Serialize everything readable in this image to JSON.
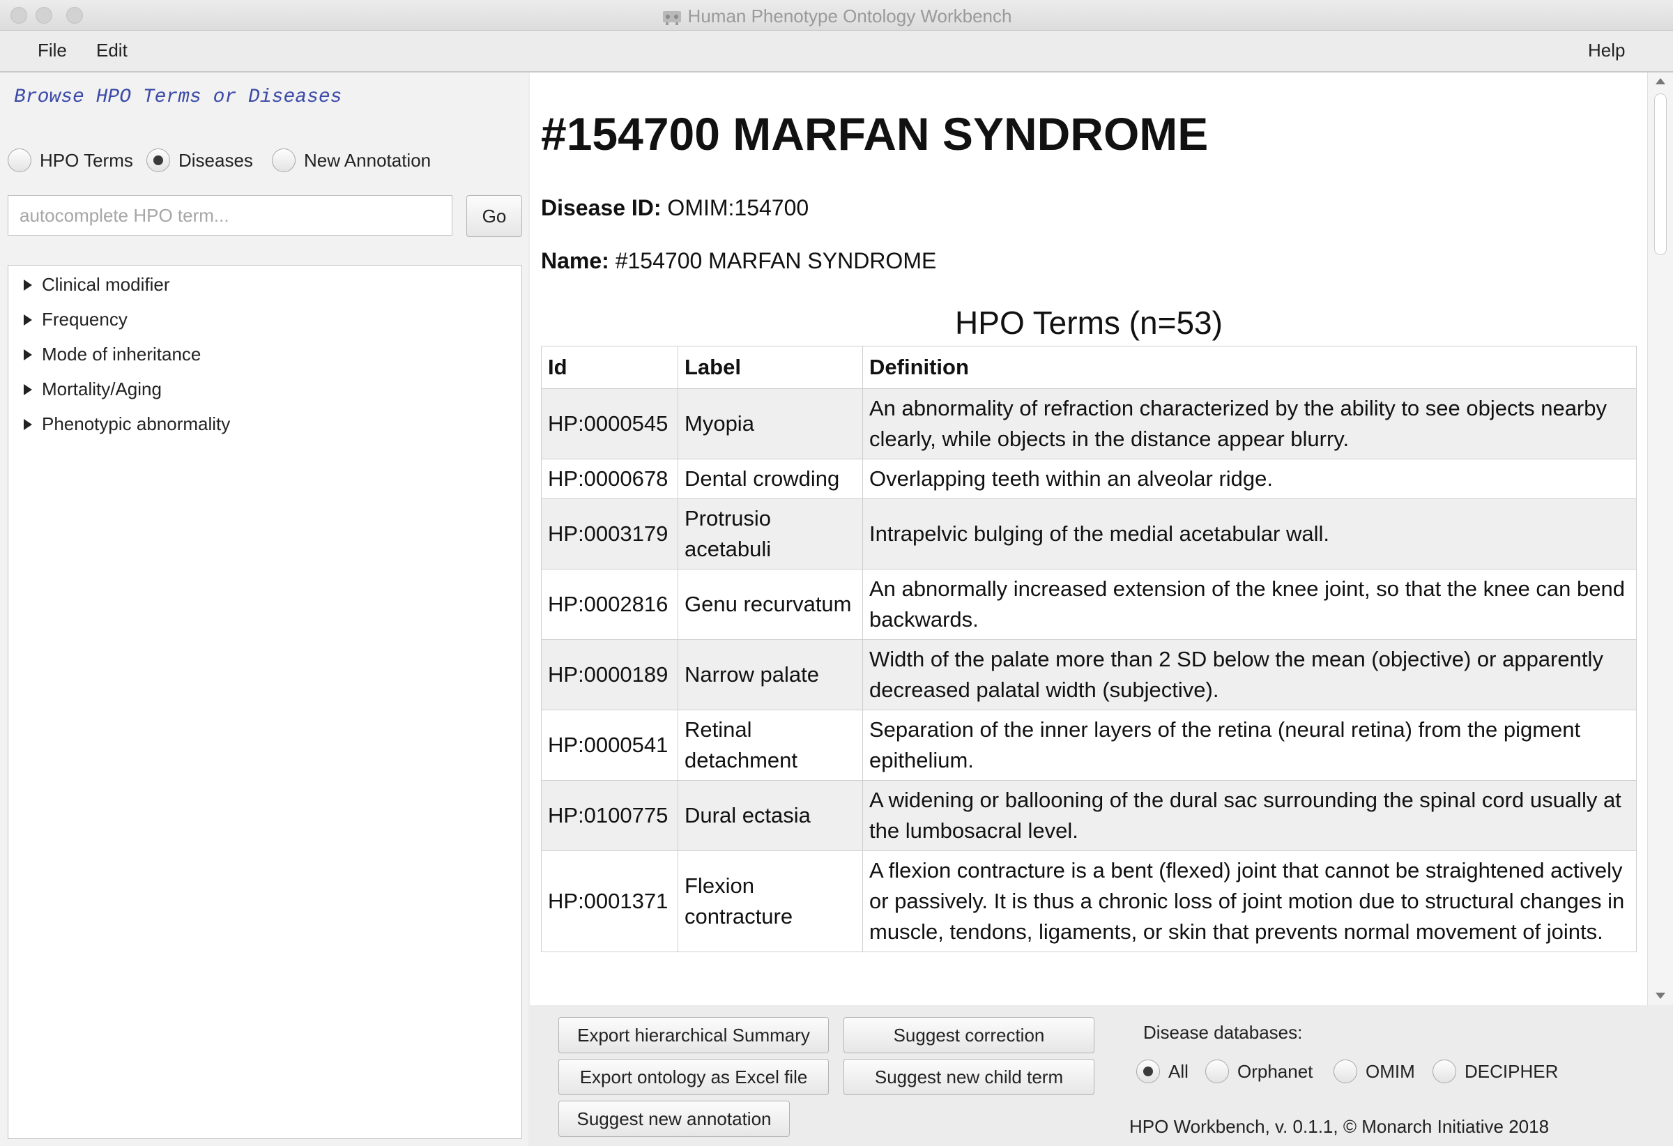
{
  "window": {
    "title": "Human Phenotype Ontology Workbench"
  },
  "menu": {
    "file": "File",
    "edit": "Edit",
    "help": "Help"
  },
  "left_panel": {
    "title": "Browse HPO Terms or Diseases",
    "modes": [
      {
        "label": "HPO Terms",
        "selected": false
      },
      {
        "label": "Diseases",
        "selected": true
      },
      {
        "label": "New Annotation",
        "selected": false
      }
    ],
    "search": {
      "placeholder": "autocomplete HPO term...",
      "value": ""
    },
    "go_label": "Go",
    "tree": [
      {
        "label": "Clinical modifier"
      },
      {
        "label": "Frequency"
      },
      {
        "label": "Mode of inheritance"
      },
      {
        "label": "Mortality/Aging"
      },
      {
        "label": "Phenotypic abnormality"
      }
    ]
  },
  "disease": {
    "heading": "#154700 MARFAN SYNDROME",
    "id_label": "Disease ID:",
    "id_value": "OMIM:154700",
    "name_label": "Name:",
    "name_value": "#154700 MARFAN SYNDROME"
  },
  "hpo_table": {
    "title": "HPO Terms (n=53)",
    "columns": [
      "Id",
      "Label",
      "Definition"
    ],
    "rows": [
      {
        "id": "HP:0000545",
        "label": "Myopia",
        "definition": "An abnormality of refraction characterized by the ability to see objects nearby clearly, while objects in the distance appear blurry."
      },
      {
        "id": "HP:0000678",
        "label": "Dental crowding",
        "definition": "Overlapping teeth within an alveolar ridge."
      },
      {
        "id": "HP:0003179",
        "label": "Protrusio acetabuli",
        "definition": "Intrapelvic bulging of the medial acetabular wall."
      },
      {
        "id": "HP:0002816",
        "label": "Genu recurvatum",
        "definition": "An abnormally increased extension of the knee joint, so that the knee can bend backwards."
      },
      {
        "id": "HP:0000189",
        "label": "Narrow palate",
        "definition": "Width of the palate more than 2 SD below the mean (objective) or apparently decreased palatal width (subjective)."
      },
      {
        "id": "HP:0000541",
        "label": "Retinal detachment",
        "definition": "Separation of the inner layers of the retina (neural retina) from the pigment epithelium."
      },
      {
        "id": "HP:0100775",
        "label": "Dural ectasia",
        "definition": "A widening or ballooning of the dural sac surrounding the spinal cord usually at the lumbosacral level."
      },
      {
        "id": "HP:0001371",
        "label": "Flexion contracture",
        "definition": "A flexion contracture is a bent (flexed) joint that cannot be straightened actively or passively. It is thus a chronic loss of joint motion due to structural changes in muscle, tendons, ligaments, or skin that prevents normal movement of joints."
      }
    ]
  },
  "actions": {
    "export_summary": "Export hierarchical Summary",
    "export_excel": "Export ontology as Excel file",
    "suggest_annotation": "Suggest new annotation",
    "suggest_correction": "Suggest correction",
    "suggest_child": "Suggest new child term"
  },
  "databases": {
    "label": "Disease databases:",
    "options": [
      {
        "label": "All",
        "selected": true
      },
      {
        "label": "Orphanet",
        "selected": false
      },
      {
        "label": "OMIM",
        "selected": false
      },
      {
        "label": "DECIPHER",
        "selected": false
      }
    ]
  },
  "footer": "HPO Workbench, v. 0.1.1, © Monarch Initiative 2018"
}
